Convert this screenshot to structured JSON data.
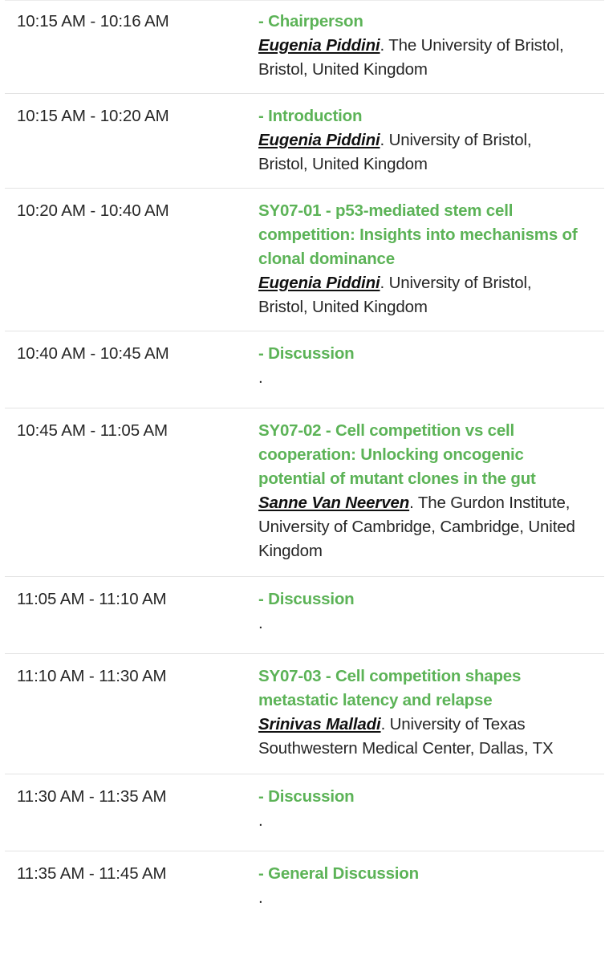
{
  "schedule": {
    "accent_color": "#5cb357",
    "text_color": "#262626",
    "divider_color": "#e3e3e3",
    "rows": [
      {
        "time": "10:15 AM - 10:16 AM",
        "title": "- Chairperson",
        "presenter_name": "Eugenia Piddini",
        "presenter_affiliation": ". The University of Bristol, Bristol, United Kingdom"
      },
      {
        "time": "10:15 AM - 10:20 AM",
        "title": "- Introduction",
        "presenter_name": "Eugenia Piddini",
        "presenter_affiliation": ". University of Bristol, Bristol, United Kingdom"
      },
      {
        "time": "10:20 AM - 10:40 AM",
        "title": "SY07-01 - p53-mediated stem cell competition: Insights into mechanisms of clonal dominance",
        "presenter_name": "Eugenia Piddini",
        "presenter_affiliation": ". University of Bristol, Bristol, United Kingdom"
      },
      {
        "time": "10:40 AM - 10:45 AM",
        "title": "- Discussion",
        "presenter_name": "",
        "presenter_affiliation": "."
      },
      {
        "time": "10:45 AM - 11:05 AM",
        "title": "SY07-02 - Cell competition vs cell cooperation: Unlocking oncogenic potential of mutant clones in the gut",
        "presenter_name": "Sanne Van Neerven",
        "presenter_affiliation": ". The Gurdon Institute, University of Cambridge, Cambridge, United Kingdom"
      },
      {
        "time": "11:05 AM - 11:10 AM",
        "title": "- Discussion",
        "presenter_name": "",
        "presenter_affiliation": "."
      },
      {
        "time": "11:10 AM - 11:30 AM",
        "title": "SY07-03 - Cell competition shapes metastatic latency and relapse",
        "presenter_name": "Srinivas Malladi",
        "presenter_affiliation": ". University of Texas Southwestern Medical Center, Dallas, TX"
      },
      {
        "time": "11:30 AM - 11:35 AM",
        "title": "- Discussion",
        "presenter_name": "",
        "presenter_affiliation": "."
      },
      {
        "time": "11:35 AM - 11:45 AM",
        "title": "- General Discussion",
        "presenter_name": "",
        "presenter_affiliation": "."
      }
    ]
  }
}
